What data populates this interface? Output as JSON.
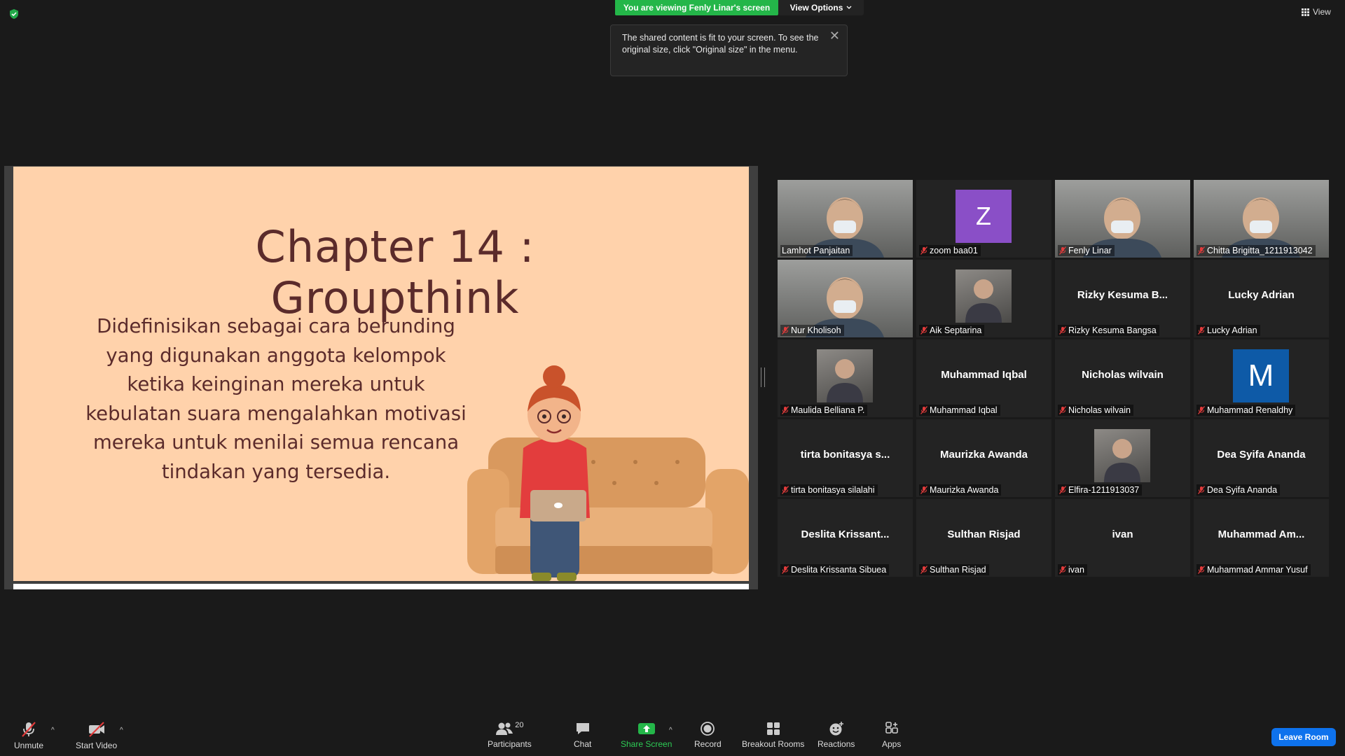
{
  "banner": {
    "viewing_text": "You are viewing Fenly Linar's screen",
    "view_options_label": "View Options",
    "top_right_view_label": "View"
  },
  "tooltip": {
    "text": "The shared content is fit to your screen. To see the original size, click \"Original size\" in the menu."
  },
  "slide": {
    "title": "Chapter 14 : Groupthink",
    "body_lines": [
      "Didefinisikan sebagai cara berunding",
      "yang digunakan anggota kelompok",
      "ketika keinginan mereka untuk",
      "kebulatan suara mengalahkan motivasi",
      "mereka untuk menilai semua rencana",
      "tindakan yang tersedia."
    ]
  },
  "participants": [
    {
      "name": "Lamhot Panjaitan",
      "big": "",
      "kind": "video",
      "muted": false,
      "active": true
    },
    {
      "name": "zoom baa01",
      "big": "Z",
      "kind": "avatar",
      "color": "#8a4fc7",
      "muted": true
    },
    {
      "name": "Fenly Linar",
      "big": "",
      "kind": "video",
      "muted": true
    },
    {
      "name": "Chitta Brigitta_1211913042",
      "big": "",
      "kind": "video",
      "muted": true
    },
    {
      "name": "Nur Kholisoh",
      "big": "",
      "kind": "video",
      "muted": true
    },
    {
      "name": "Aik Septarina",
      "big": "",
      "kind": "photo",
      "muted": true
    },
    {
      "name": "Rizky Kesuma Bangsa",
      "big": "Rizky  Kesuma  B...",
      "kind": "text",
      "muted": true
    },
    {
      "name": "Lucky Adrian",
      "big": "Lucky Adrian",
      "kind": "text",
      "muted": true
    },
    {
      "name": "Maulida Belliana P.",
      "big": "",
      "kind": "photo",
      "muted": true
    },
    {
      "name": "Muhammad Iqbal",
      "big": "Muhammad Iqbal",
      "kind": "text",
      "muted": true
    },
    {
      "name": "Nicholas wilvain",
      "big": "Nicholas wilvain",
      "kind": "text",
      "muted": true
    },
    {
      "name": "Muhammad Renaldhy",
      "big": "M",
      "kind": "avatar",
      "color": "#0e5aa7",
      "muted": true
    },
    {
      "name": "tirta bonitasya silalahi",
      "big": "tirta  bonitasya  s...",
      "kind": "text",
      "muted": true
    },
    {
      "name": "Maurizka Awanda",
      "big": "Maurizka Awanda",
      "kind": "text",
      "muted": true
    },
    {
      "name": "Elfira-1211913037",
      "big": "",
      "kind": "photo",
      "muted": true
    },
    {
      "name": "Dea Syifa Ananda",
      "big": "Dea Syifa Ananda",
      "kind": "text",
      "muted": true
    },
    {
      "name": "Deslita Krissanta Sibuea",
      "big": "Deslita  Krissant...",
      "kind": "text",
      "muted": true
    },
    {
      "name": "Sulthan Risjad",
      "big": "Sulthan Risjad",
      "kind": "text",
      "muted": true
    },
    {
      "name": "ivan",
      "big": "ivan",
      "kind": "text",
      "muted": true
    },
    {
      "name": "Muhammad Ammar Yusuf",
      "big": "Muhammad  Am...",
      "kind": "text",
      "muted": true
    }
  ],
  "toolbar": {
    "unmute": "Unmute",
    "start_video": "Start Video",
    "participants": "Participants",
    "participants_count": "20",
    "chat": "Chat",
    "share_screen": "Share Screen",
    "record": "Record",
    "breakout_rooms": "Breakout Rooms",
    "reactions": "Reactions",
    "apps": "Apps",
    "leave_room": "Leave Room"
  },
  "colors": {
    "banner_green": "#24b649",
    "slide_bg": "#ffd2ab",
    "slide_text": "#5b2b2b",
    "leave_blue": "#0e72ed",
    "share_green": "#2dcc55",
    "active_speaker": "#e9f07a"
  }
}
